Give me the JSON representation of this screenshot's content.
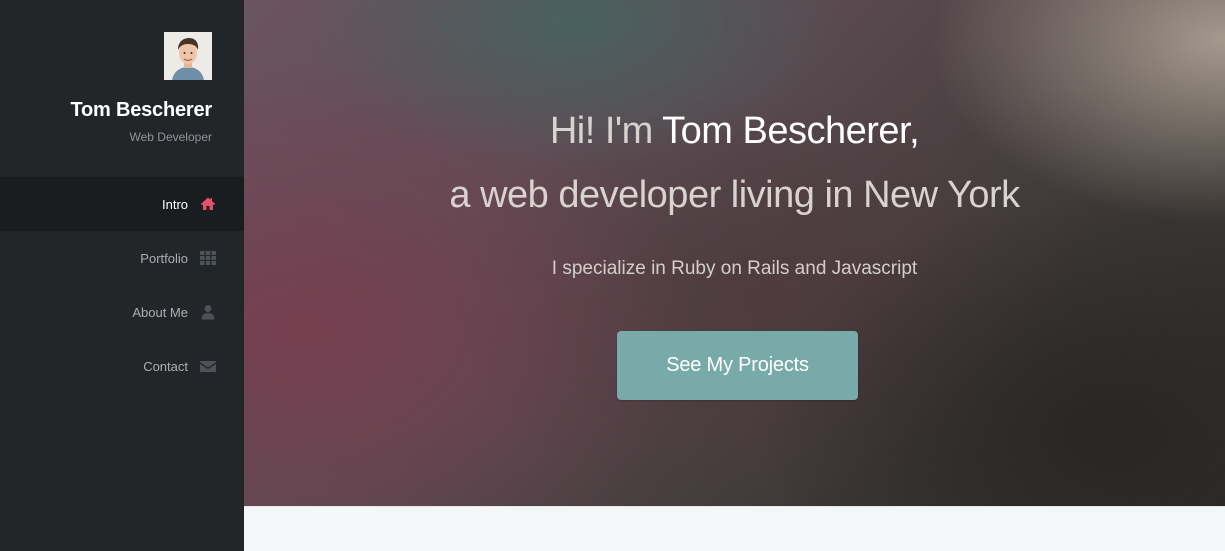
{
  "profile": {
    "name": "Tom Bescherer",
    "role": "Web Developer"
  },
  "nav": {
    "items": [
      {
        "label": "Intro",
        "icon": "home-icon",
        "active": true
      },
      {
        "label": "Portfolio",
        "icon": "grid-icon",
        "active": false
      },
      {
        "label": "About Me",
        "icon": "user-icon",
        "active": false
      },
      {
        "label": "Contact",
        "icon": "envelope-icon",
        "active": false
      }
    ]
  },
  "hero": {
    "greeting": "Hi! I'm ",
    "name": "Tom Bescherer,",
    "tagline": "a web developer living in New York",
    "subtitle": "I specialize in Ruby on Rails and Javascript",
    "cta_label": "See My Projects"
  },
  "colors": {
    "sidebar_bg": "#222629",
    "active_icon": "#e0536b",
    "inactive_icon": "#4c5257",
    "cta_bg": "#78aaa9"
  }
}
